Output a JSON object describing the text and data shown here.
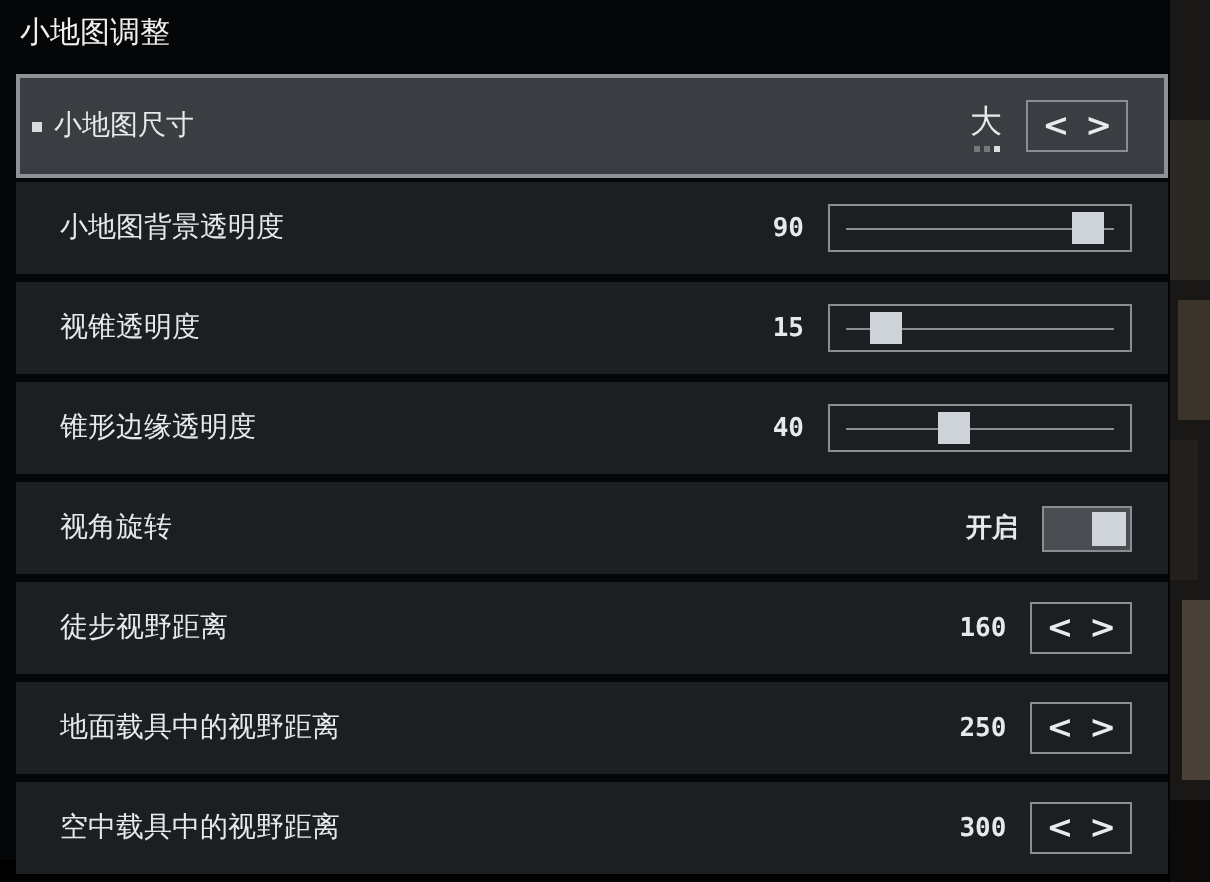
{
  "window": {
    "title": "小地图调整"
  },
  "settings": [
    {
      "kind": "selector",
      "label": "小地图尺寸",
      "selected": true,
      "value": "大",
      "options": [
        {
          "selected": false
        },
        {
          "selected": false
        },
        {
          "selected": true
        }
      ],
      "prev": "<",
      "next": ">"
    },
    {
      "kind": "slider",
      "label": "小地图背景透明度",
      "selected": false,
      "value": "90",
      "level": 0.9
    },
    {
      "kind": "slider",
      "label": "视锥透明度",
      "selected": false,
      "value": "15",
      "level": 0.15
    },
    {
      "kind": "slider",
      "label": "锥形边缘透明度",
      "selected": false,
      "value": "40",
      "level": 0.4
    },
    {
      "kind": "toggle",
      "label": "视角旋转",
      "selected": false,
      "value": "开启",
      "on": true
    },
    {
      "kind": "selector",
      "label": "徒步视野距离",
      "selected": false,
      "value": "160",
      "prev": "<",
      "next": ">"
    },
    {
      "kind": "selector",
      "label": "地面载具中的视野距离",
      "selected": false,
      "value": "250",
      "prev": "<",
      "next": ">"
    },
    {
      "kind": "selector",
      "label": "空中载具中的视野距离",
      "selected": false,
      "value": "300",
      "prev": "<",
      "next": ">"
    }
  ]
}
